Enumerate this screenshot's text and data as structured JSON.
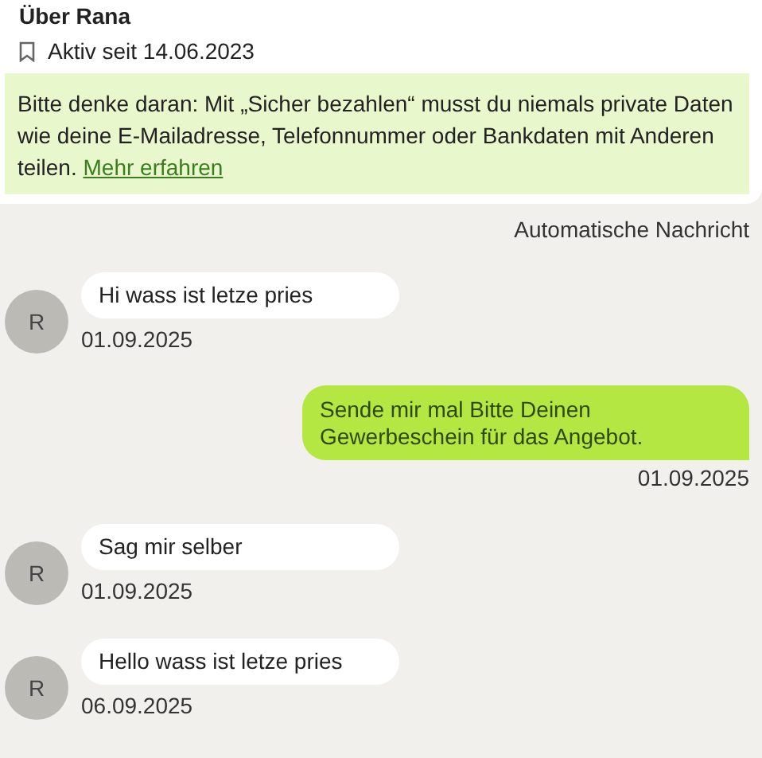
{
  "profile": {
    "title": "Über Rana",
    "active_since": "Aktiv seit 14.06.2023"
  },
  "notice": {
    "text": "Bitte denke daran: Mit „Sicher bezahlen“ musst du niemals private Daten wie deine E-Mailadresse, Telefonnummer oder Bankdaten mit Anderen teilen.",
    "link": "Mehr erfahren"
  },
  "system_note": "Automatische Nachricht",
  "messages": [
    {
      "kind": "incoming",
      "avatar": "R",
      "text": "Hi wass ist letze pries",
      "date": "01.09.2025"
    },
    {
      "kind": "outgoing",
      "text": "Sende mir mal Bitte Deinen Gewerbeschein für das Angebot.",
      "date": "01.09.2025"
    },
    {
      "kind": "incoming",
      "avatar": "R",
      "text": "Sag mir selber",
      "date": "01.09.2025"
    },
    {
      "kind": "incoming",
      "avatar": "R",
      "text": "Hello wass ist letze pries",
      "date": "06.09.2025"
    }
  ]
}
